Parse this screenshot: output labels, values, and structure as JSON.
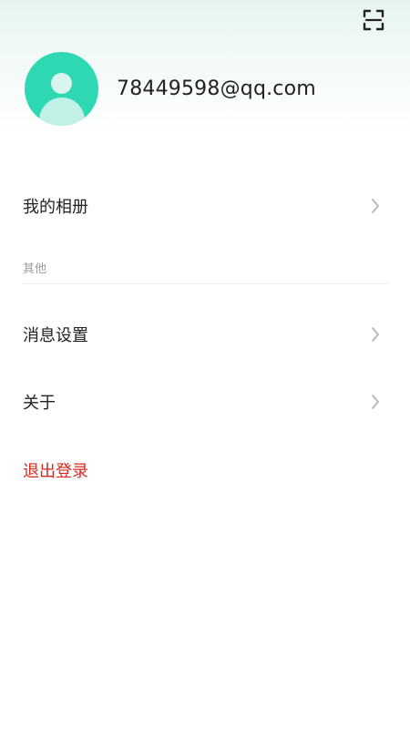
{
  "header": {
    "scan_icon": "scan-icon"
  },
  "profile": {
    "avatar_icon": "default-avatar",
    "account": "78449598@qq.com"
  },
  "menu": {
    "album_label": "我的相册",
    "section_other": "其他",
    "message_settings_label": "消息设置",
    "about_label": "关于",
    "logout_label": "退出登录"
  },
  "colors": {
    "accent": "#2ed8b3",
    "logout": "#d6281f",
    "text": "#222222",
    "muted": "#9a9a9a"
  }
}
